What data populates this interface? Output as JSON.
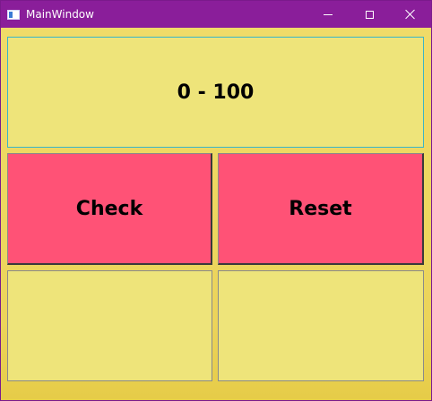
{
  "window": {
    "title": "MainWindow",
    "icon": "window-app-icon",
    "controls": {
      "minimize": "minimize-icon",
      "maximize": "maximize-icon",
      "close": "close-icon"
    },
    "colors": {
      "titlebar": "#8a1e9a",
      "background": "#e8d24e"
    }
  },
  "main": {
    "range_label": "0 - 100",
    "check_button": "Check",
    "reset_button": "Reset",
    "input_left": "",
    "input_right": "",
    "colors": {
      "button": "#ff5276",
      "panel": "#eee47a"
    }
  }
}
